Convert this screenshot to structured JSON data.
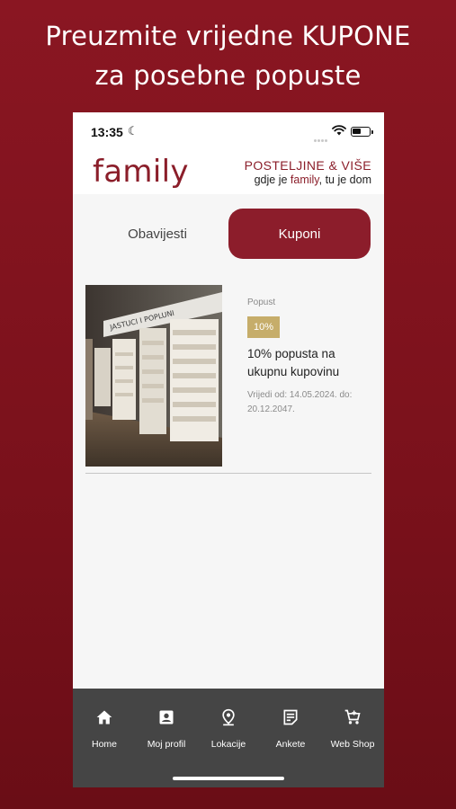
{
  "headline": {
    "line1": "Preuzmite vrijedne KUPONE",
    "line2": "za posebne popuste"
  },
  "status_bar": {
    "time": "13:35",
    "moon_glyph": "☾"
  },
  "header": {
    "logo": "family",
    "tagline": "POSTELJINE & VIŠE",
    "subtitle_pre": "gdje je ",
    "subtitle_brand": "family",
    "subtitle_post": ", tu je dom"
  },
  "tabs": {
    "notices": "Obavijesti",
    "coupons": "Kuponi",
    "active": "coupons"
  },
  "coupon": {
    "type": "Popust",
    "badge": "10%",
    "title": "10% popusta na ukupnu kupovinu",
    "validity": "Vrijedi od: 14.05.2024. do: 20.12.2047.",
    "image_sign_text": "JASTUCI I POPLUNI"
  },
  "nav": {
    "items": [
      {
        "label": "Home",
        "icon": "home-icon"
      },
      {
        "label": "Moj profil",
        "icon": "profile-icon"
      },
      {
        "label": "Lokacije",
        "icon": "location-icon"
      },
      {
        "label": "Ankete",
        "icon": "survey-icon"
      },
      {
        "label": "Web Shop",
        "icon": "cart-icon"
      }
    ]
  },
  "colors": {
    "brand": "#8b1e2a",
    "badge": "#c6ad6a",
    "navbar": "#454545"
  }
}
